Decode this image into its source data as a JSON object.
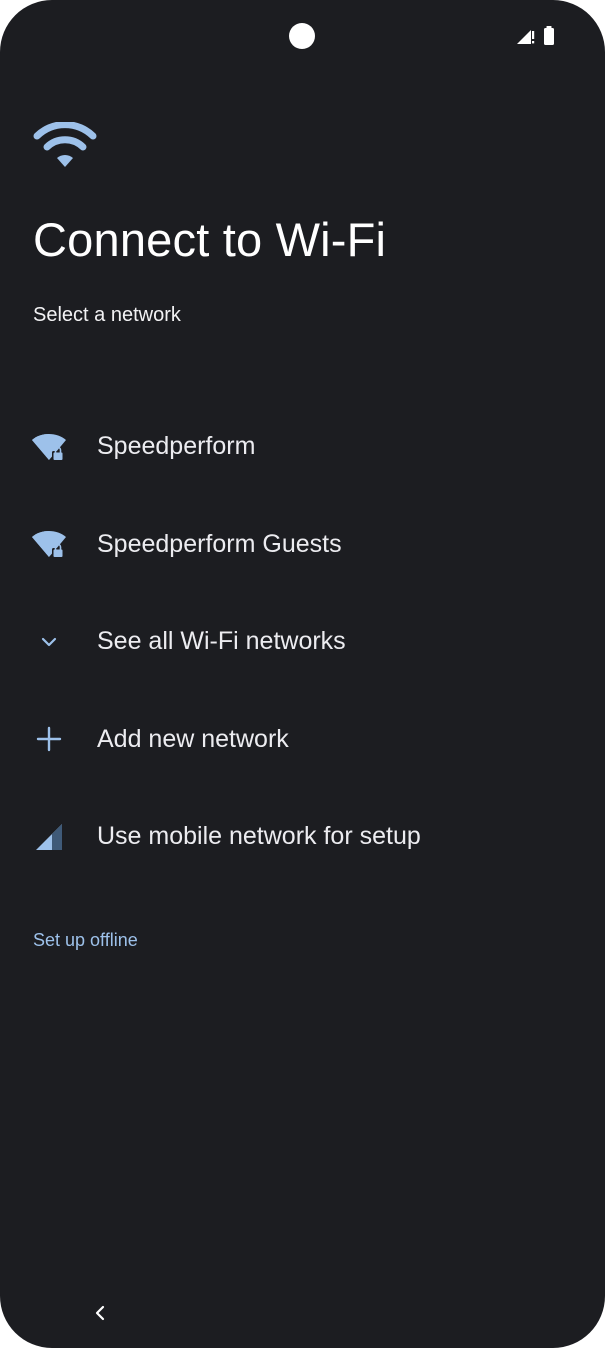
{
  "status_bar": {
    "icons": [
      "signal-alert-icon",
      "battery-icon"
    ]
  },
  "header": {
    "icon": "wifi-icon",
    "title": "Connect to Wi-Fi",
    "subtitle": "Select a network"
  },
  "networks": [
    {
      "label": "Speedperform",
      "icon": "wifi-lock-icon"
    },
    {
      "label": "Speedperform Guests",
      "icon": "wifi-lock-icon"
    },
    {
      "label": "See all Wi-Fi networks",
      "icon": "chevron-down-icon"
    },
    {
      "label": "Add new network",
      "icon": "plus-icon"
    },
    {
      "label": "Use mobile network for setup",
      "icon": "cellular-signal-icon"
    }
  ],
  "footer": {
    "offline_label": "Set up offline"
  },
  "nav": {
    "back_icon": "back-icon"
  },
  "colors": {
    "background": "#1c1d21",
    "accent": "#9dc1ea",
    "text": "#ececf0"
  }
}
